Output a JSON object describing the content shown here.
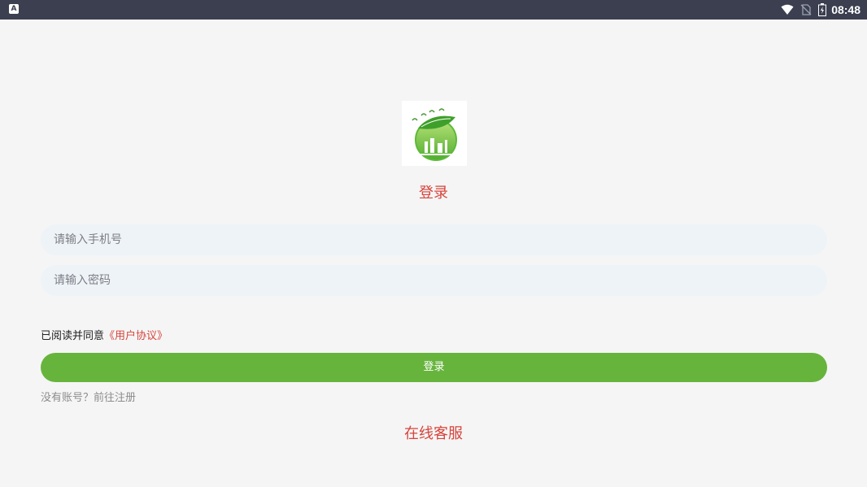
{
  "status_bar": {
    "left_icon_letter": "A",
    "time": "08:48"
  },
  "login": {
    "title": "登录",
    "phone_placeholder": "请输入手机号",
    "password_placeholder": "请输入密码",
    "agreement_prefix": "已阅读并同意",
    "agreement_link": "《用户协议》",
    "button_label": "登录",
    "register_text": "没有账号？前往注册",
    "service_text": "在线客服"
  },
  "colors": {
    "accent_red": "#d6453c",
    "button_green": "#67b43d",
    "input_bg": "#eef3f8",
    "status_bar_bg": "#3b3f50"
  },
  "icons": [
    "app-icon-notification",
    "wifi-icon",
    "no-sim-icon",
    "battery-icon",
    "app-logo"
  ]
}
